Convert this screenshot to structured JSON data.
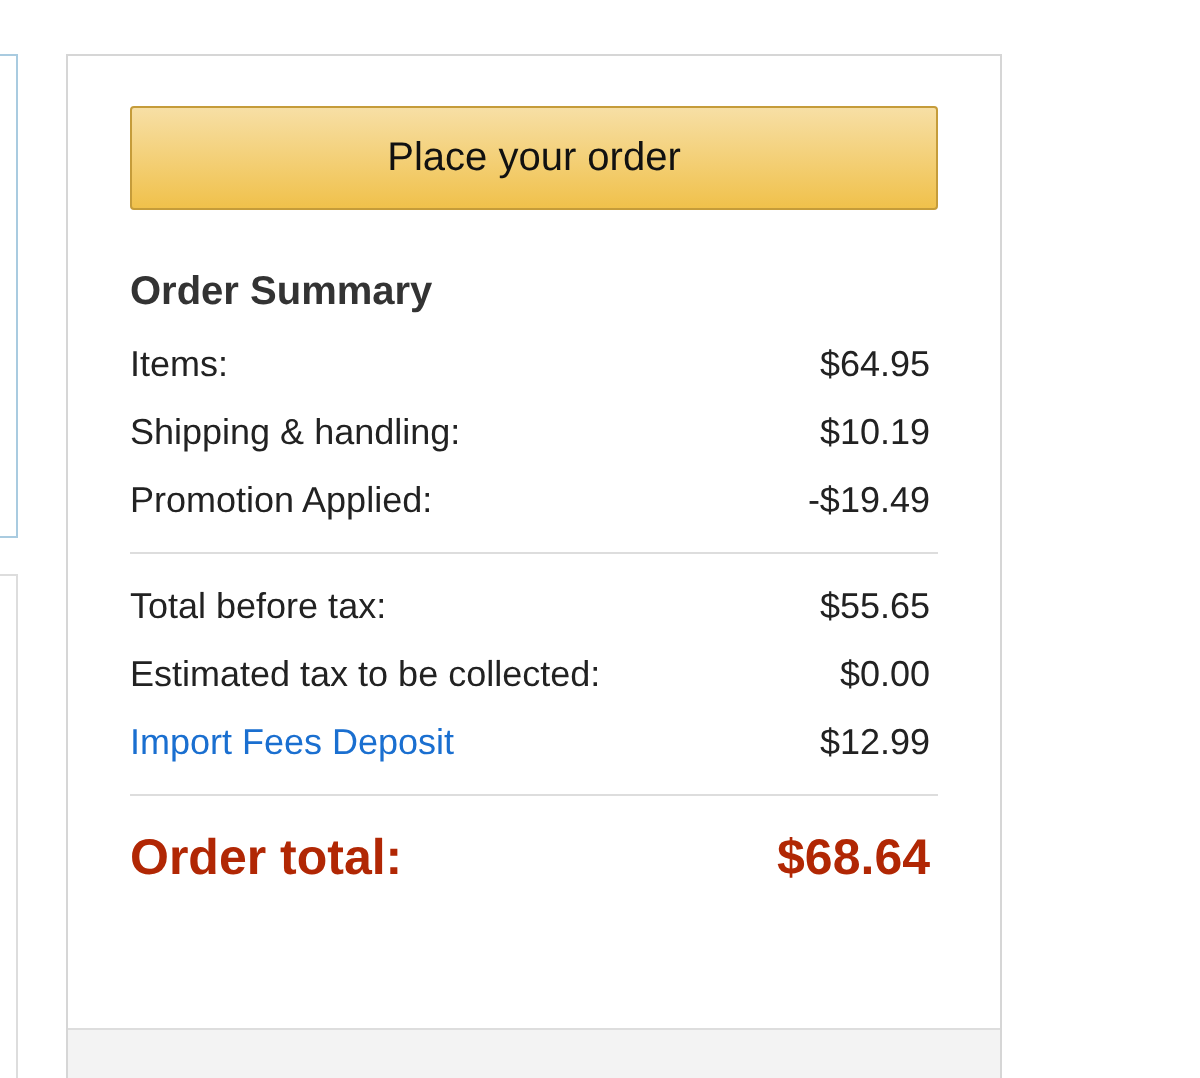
{
  "button": {
    "label": "Place your order"
  },
  "summary": {
    "title": "Order Summary",
    "sections": [
      [
        {
          "kind": "text",
          "label": "Items:",
          "amount": "$64.95"
        },
        {
          "kind": "text",
          "label": "Shipping & handling:",
          "amount": "$10.19"
        },
        {
          "kind": "text",
          "label": "Promotion Applied:",
          "amount": "-$19.49"
        }
      ],
      [
        {
          "kind": "text",
          "label": "Total before tax:",
          "amount": "$55.65"
        },
        {
          "kind": "text",
          "label": "Estimated tax to be collected:",
          "amount": "$0.00"
        },
        {
          "kind": "link",
          "label": "Import Fees Deposit",
          "amount": "$12.99"
        }
      ]
    ],
    "total": {
      "label": "Order total:",
      "amount": "$68.64"
    }
  }
}
